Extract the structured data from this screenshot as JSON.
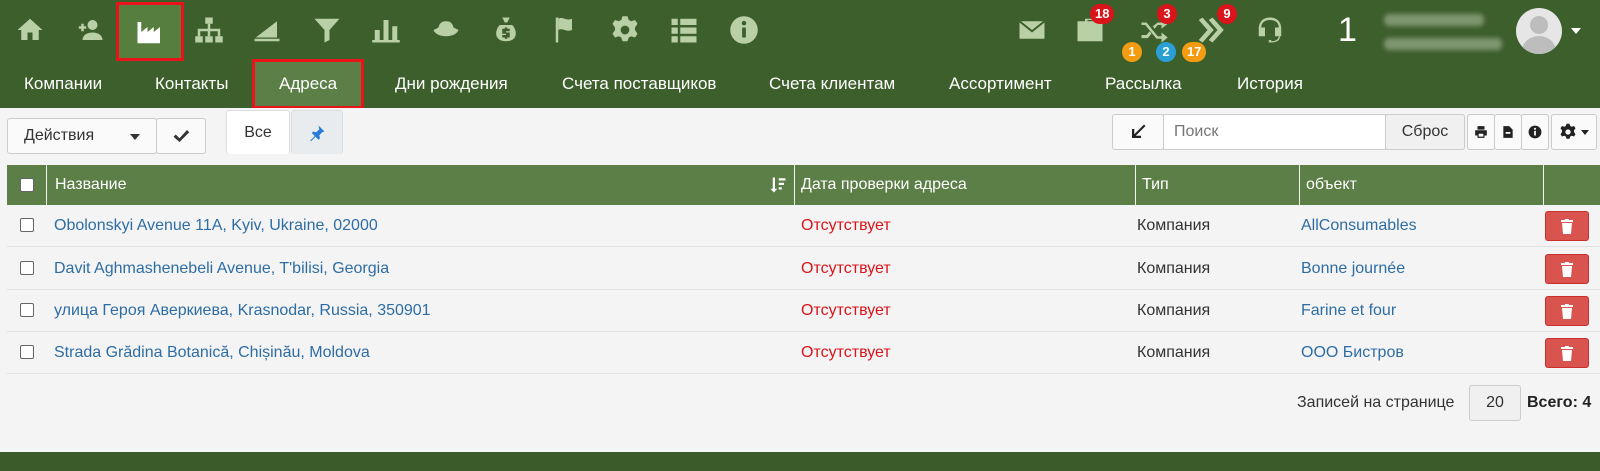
{
  "topbar": {
    "icons": [
      "home-icon",
      "contacts-icon",
      "factory-icon",
      "org-structure-icon",
      "sales-chart-icon",
      "funnel-icon",
      "bar-chart-icon",
      "hat-icon",
      "money-bag-icon",
      "flag-icon",
      "gear-icon",
      "list-icon",
      "info-icon"
    ],
    "right_icons": [
      "mail-icon",
      "briefcase-icon",
      "shuffle-icon",
      "double-chevron-icon",
      "headset-icon"
    ],
    "badges": {
      "briefcase_top": "18",
      "briefcase_bottom": "1",
      "shuffle_top": "3",
      "shuffle_bottom": "2",
      "chevron_top": "9",
      "chevron_bottom": "17"
    },
    "counter": "1"
  },
  "nav": {
    "tabs": [
      "Компании",
      "Контакты",
      "Адреса",
      "Дни рождения",
      "Счета поставщиков",
      "Счета клиентам",
      "Ассортимент",
      "Рассылка",
      "История"
    ],
    "active": "Адреса"
  },
  "toolbar": {
    "actions_label": "Действия",
    "filter_all": "Все",
    "search_placeholder": "Поиск",
    "reset_label": "Сброс"
  },
  "table": {
    "columns": [
      "Название",
      "Дата проверки адреса",
      "Тип",
      "объект"
    ],
    "rows": [
      {
        "name": "Obolonskyi Avenue 11A, Kyiv, Ukraine, 02000",
        "check_date": "Отсутствует",
        "type": "Компания",
        "object": "AllConsumables"
      },
      {
        "name": "Davit Aghmashenebeli Avenue, T'bilisi, Georgia",
        "check_date": "Отсутствует",
        "type": "Компания",
        "object": "Bonne journée"
      },
      {
        "name": "улица Героя Аверкиева, Krasnodar, Russia, 350901",
        "check_date": "Отсутствует",
        "type": "Компания",
        "object": "Farine et four"
      },
      {
        "name": "Strada Grădina Botanică, Chișinău, Moldova",
        "check_date": "Отсутствует",
        "type": "Компания",
        "object": "ООО Бистров"
      }
    ]
  },
  "pagination": {
    "per_page_label": "Записей на странице",
    "per_page_value": "20",
    "total_label": "Всего: 4"
  },
  "colors": {
    "header_green": "#3d5f2c",
    "accent_green": "#5b7f47",
    "link_blue": "#2e6da4",
    "absent_red": "#d9141a",
    "highlight_red": "#e8141a"
  }
}
